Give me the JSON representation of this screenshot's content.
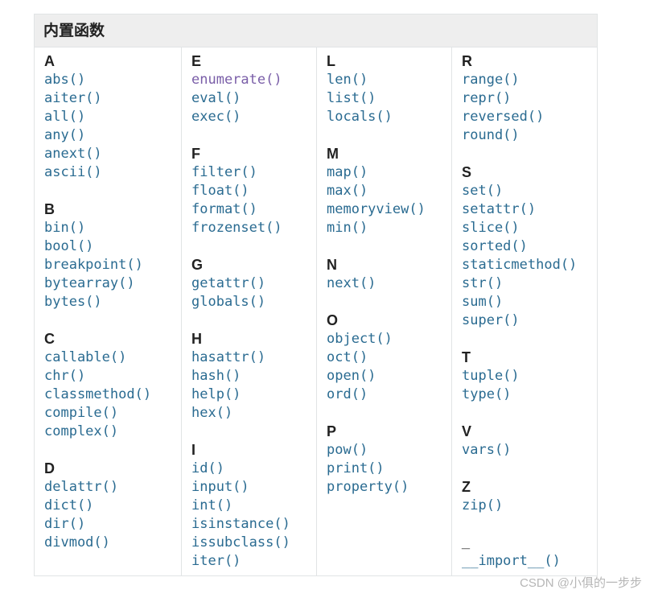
{
  "table": {
    "header": "内置函数",
    "columns": [
      [
        {
          "letter": "A",
          "items": [
            {
              "label": "abs()"
            },
            {
              "label": "aiter()"
            },
            {
              "label": "all()"
            },
            {
              "label": "any()"
            },
            {
              "label": "anext()"
            },
            {
              "label": "ascii()"
            }
          ]
        },
        {
          "letter": "B",
          "items": [
            {
              "label": "bin()"
            },
            {
              "label": "bool()"
            },
            {
              "label": "breakpoint()"
            },
            {
              "label": "bytearray()"
            },
            {
              "label": "bytes()"
            }
          ]
        },
        {
          "letter": "C",
          "items": [
            {
              "label": "callable()"
            },
            {
              "label": "chr()"
            },
            {
              "label": "classmethod()"
            },
            {
              "label": "compile()"
            },
            {
              "label": "complex()"
            }
          ]
        },
        {
          "letter": "D",
          "items": [
            {
              "label": "delattr()"
            },
            {
              "label": "dict()"
            },
            {
              "label": "dir()"
            },
            {
              "label": "divmod()"
            }
          ]
        }
      ],
      [
        {
          "letter": "E",
          "items": [
            {
              "label": "enumerate()",
              "visited": true
            },
            {
              "label": "eval()"
            },
            {
              "label": "exec()"
            }
          ]
        },
        {
          "letter": "F",
          "items": [
            {
              "label": "filter()"
            },
            {
              "label": "float()"
            },
            {
              "label": "format()"
            },
            {
              "label": "frozenset()"
            }
          ]
        },
        {
          "letter": "G",
          "items": [
            {
              "label": "getattr()"
            },
            {
              "label": "globals()"
            }
          ]
        },
        {
          "letter": "H",
          "items": [
            {
              "label": "hasattr()"
            },
            {
              "label": "hash()"
            },
            {
              "label": "help()"
            },
            {
              "label": "hex()"
            }
          ]
        },
        {
          "letter": "I",
          "items": [
            {
              "label": "id()"
            },
            {
              "label": "input()"
            },
            {
              "label": "int()"
            },
            {
              "label": "isinstance()"
            },
            {
              "label": "issubclass()"
            },
            {
              "label": "iter()"
            }
          ]
        }
      ],
      [
        {
          "letter": "L",
          "items": [
            {
              "label": "len()"
            },
            {
              "label": "list()"
            },
            {
              "label": "locals()"
            }
          ]
        },
        {
          "letter": "M",
          "items": [
            {
              "label": "map()"
            },
            {
              "label": "max()"
            },
            {
              "label": "memoryview()"
            },
            {
              "label": "min()"
            }
          ]
        },
        {
          "letter": "N",
          "items": [
            {
              "label": "next()"
            }
          ]
        },
        {
          "letter": "O",
          "items": [
            {
              "label": "object()"
            },
            {
              "label": "oct()"
            },
            {
              "label": "open()"
            },
            {
              "label": "ord()"
            }
          ]
        },
        {
          "letter": "P",
          "items": [
            {
              "label": "pow()"
            },
            {
              "label": "print()"
            },
            {
              "label": "property()"
            }
          ]
        }
      ],
      [
        {
          "letter": "R",
          "items": [
            {
              "label": "range()"
            },
            {
              "label": "repr()"
            },
            {
              "label": "reversed()"
            },
            {
              "label": "round()"
            }
          ]
        },
        {
          "letter": "S",
          "items": [
            {
              "label": "set()"
            },
            {
              "label": "setattr()"
            },
            {
              "label": "slice()"
            },
            {
              "label": "sorted()"
            },
            {
              "label": "staticmethod()"
            },
            {
              "label": "str()"
            },
            {
              "label": "sum()"
            },
            {
              "label": "super()"
            }
          ]
        },
        {
          "letter": "T",
          "items": [
            {
              "label": "tuple()"
            },
            {
              "label": "type()"
            }
          ]
        },
        {
          "letter": "V",
          "items": [
            {
              "label": "vars()"
            }
          ]
        },
        {
          "letter": "Z",
          "items": [
            {
              "label": "zip()"
            }
          ]
        },
        {
          "letter": "_",
          "items": [
            {
              "label": "__import__()"
            }
          ]
        }
      ]
    ]
  },
  "watermark": "CSDN @小俱的一步步",
  "colors": {
    "link": "#2a6b91",
    "visited": "#7a5ea8",
    "header_bg": "#eeeeee",
    "border": "#e1e4e5"
  }
}
